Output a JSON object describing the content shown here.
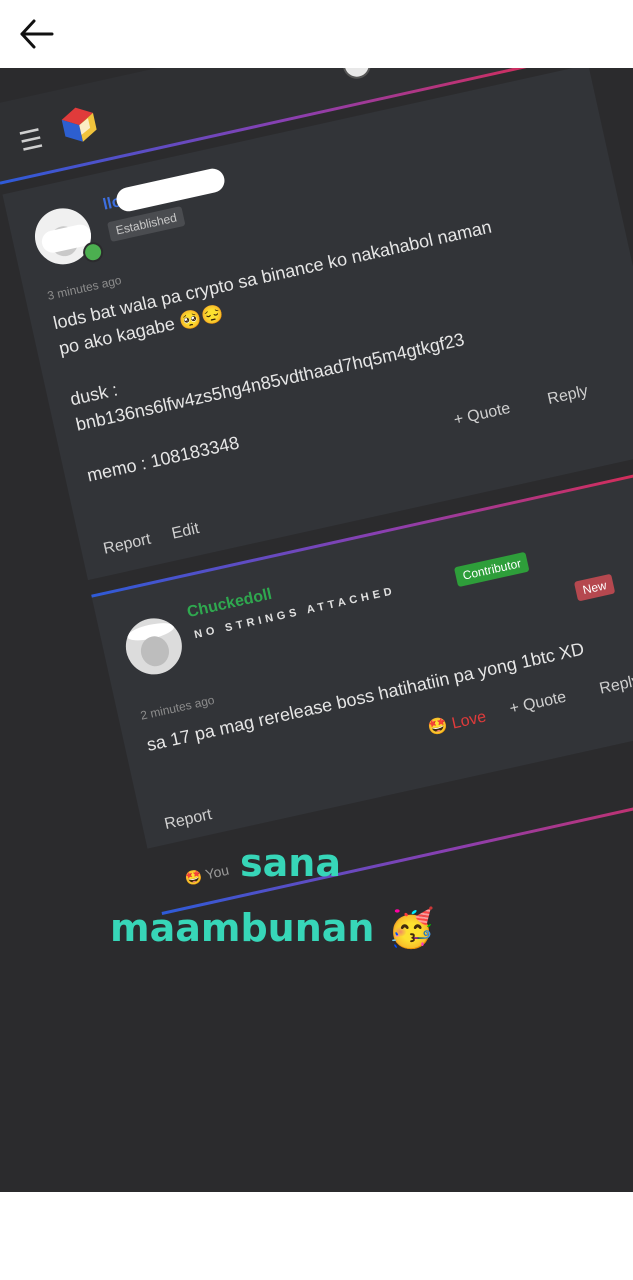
{
  "nav": {
    "back_icon": "arrow-left-icon"
  },
  "header": {
    "menu_icon": "hamburger-icon",
    "logo_icon": "cube-logo-icon",
    "icons": [
      "avatar-icon",
      "mail-icon",
      "bell-icon",
      "document-icon",
      "search-icon"
    ]
  },
  "post1": {
    "username": "llo",
    "badge": "Established",
    "timestamp": "3 minutes ago",
    "text_lines": [
      "lods bat wala pa crypto sa binance ko nakahabol naman",
      "po ako kagabe 🥺😔"
    ],
    "dusk_label": "dusk :",
    "address": "bnb136ns6lfw4zs5hg4n85vdthaad7hq5m4gtkgf23",
    "memo": "memo : 108183348",
    "quote": "+ Quote",
    "reply": "Reply",
    "report": "Report",
    "edit": "Edit"
  },
  "post2": {
    "username": "Chuckedoll",
    "tagline": "NO STRINGS ATTACHED",
    "badge": "Contributor",
    "new_label": "New",
    "timestamp": "2 minutes ago",
    "text": "sa 17 pa mag rerelease boss hatihatiin pa yong 1btc XD",
    "love": "🤩 Love",
    "quote": "+ Quote",
    "reply": "Reply",
    "report": "Report",
    "reaction": "🤩 You"
  },
  "overlay": {
    "line1": "sana",
    "line2": "maambunan 🥳"
  }
}
